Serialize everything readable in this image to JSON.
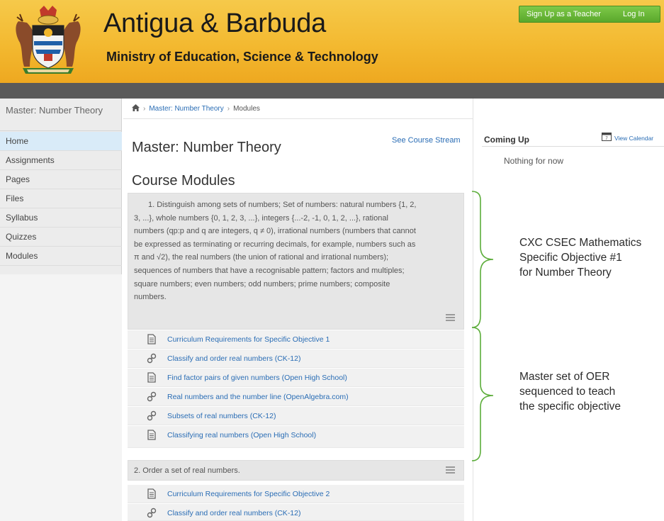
{
  "header": {
    "site_title": "Antigua & Barbuda",
    "site_subtitle": "Ministry of Education, Science & Technology",
    "signup_label": "Sign Up as a Teacher",
    "login_label": "Log In"
  },
  "colors": {
    "header_accent": "#f3b930",
    "link": "#2a6db5",
    "topbar_green": "#5aa82c",
    "annotation_bracket": "#5cad3a"
  },
  "sidebar": {
    "course_name": "Master: Number Theory",
    "items": [
      {
        "label": "Home",
        "active": true
      },
      {
        "label": "Assignments"
      },
      {
        "label": "Pages"
      },
      {
        "label": "Files"
      },
      {
        "label": "Syllabus"
      },
      {
        "label": "Quizzes"
      },
      {
        "label": "Modules"
      }
    ]
  },
  "breadcrumb": {
    "home_icon": "home-icon",
    "course": "Master: Number Theory",
    "current": "Modules"
  },
  "main": {
    "page_title": "Master: Number Theory",
    "see_course_stream": "See Course Stream",
    "modules_heading": "Course Modules",
    "modules": [
      {
        "text_lines": [
          "1. Distinguish among sets of numbers; Set of numbers: natural numbers {1, 2,",
          "3, ...}, whole numbers {0, 1, 2, 3, ...}, integers {...-2, -1, 0, 1, 2, ...}, rational",
          "numbers (qp:p and q are integers, q ≠ 0), irrational numbers (numbers that cannot",
          "be expressed as terminating or recurring decimals, for example, numbers such as",
          "π and √2), the real numbers (the union of rational and irrational numbers);",
          "sequences of numbers that have a recognisable pattern; factors and multiples;",
          "square numbers; even numbers; odd numbers; prime numbers; composite",
          "numbers."
        ],
        "items": [
          {
            "icon": "document-icon",
            "label": "Curriculum Requirements for Specific Objective 1"
          },
          {
            "icon": "link-icon",
            "label": "Classify and order real numbers (CK-12)"
          },
          {
            "icon": "document-icon",
            "label": "Find factor pairs of given numbers (Open High School)"
          },
          {
            "icon": "link-icon",
            "label": "Real numbers and the number line (OpenAlgebra.com)"
          },
          {
            "icon": "link-icon",
            "label": "Subsets of real numbers (CK-12)"
          },
          {
            "icon": "document-icon",
            "label": "Classifying real numbers (Open High School)"
          }
        ]
      },
      {
        "text_lines": [
          "2. Order a set of real numbers."
        ],
        "items": [
          {
            "icon": "document-icon",
            "label": "Curriculum Requirements for Specific Objective 2"
          },
          {
            "icon": "link-icon",
            "label": "Classify and order real numbers (CK-12)"
          }
        ]
      }
    ]
  },
  "right": {
    "coming_up": "Coming Up",
    "view_calendar": "View Calendar",
    "nothing": "Nothing for now"
  },
  "annotations": {
    "objective_lines": [
      "CXC CSEC Mathematics",
      "Specific Objective #1",
      "for Number Theory"
    ],
    "oer_lines": [
      "Master set of OER",
      "sequenced to teach",
      "the specific objective"
    ]
  }
}
